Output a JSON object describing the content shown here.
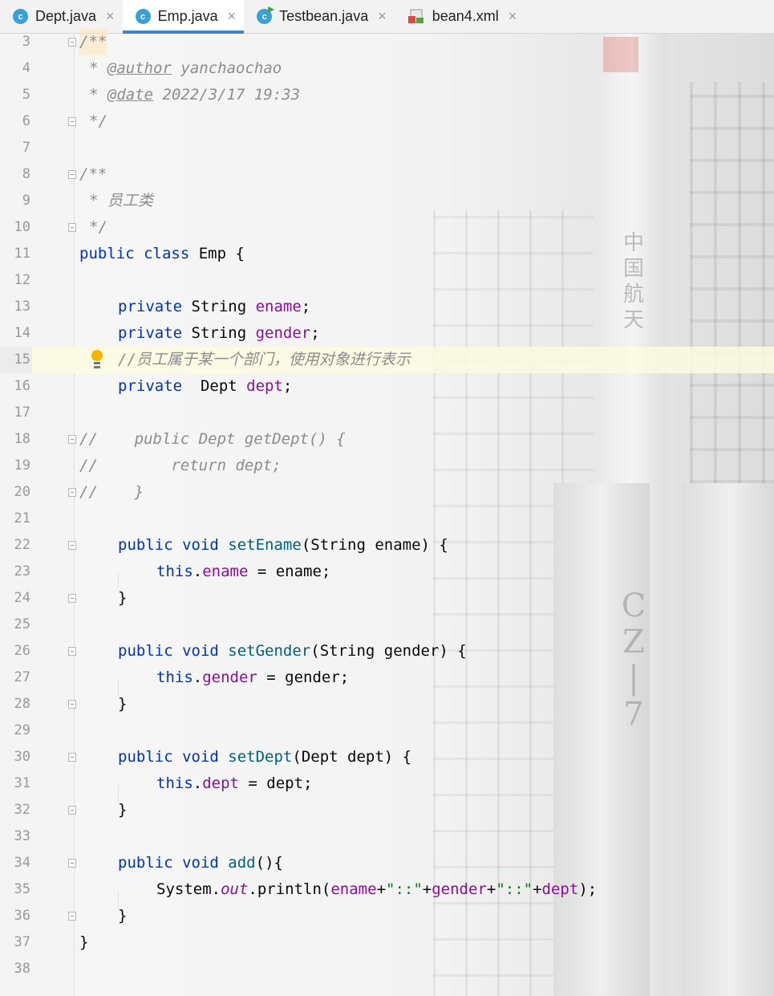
{
  "tabs": [
    {
      "label": "Dept.java",
      "icon": "java-class-icon",
      "close": "×"
    },
    {
      "label": "Emp.java",
      "icon": "java-class-icon",
      "close": "×"
    },
    {
      "label": "Testbean.java",
      "icon": "java-runnable-class-icon",
      "close": "×"
    },
    {
      "label": "bean4.xml",
      "icon": "xml-file-icon",
      "close": "×"
    }
  ],
  "active_tab": "Emp.java",
  "current_line": 15,
  "line_numbers": [
    "3",
    "4",
    "5",
    "6",
    "7",
    "8",
    "9",
    "10",
    "11",
    "12",
    "13",
    "14",
    "15",
    "16",
    "17",
    "18",
    "19",
    "20",
    "21",
    "22",
    "23",
    "24",
    "25",
    "26",
    "27",
    "28",
    "29",
    "30",
    "31",
    "32",
    "33",
    "34",
    "35",
    "36",
    "37",
    "38"
  ],
  "code": {
    "l3": {
      "a": "/**"
    },
    "l4": {
      "a": "* ",
      "b": "@author",
      "c": " yanchaochao"
    },
    "l5": {
      "a": "* ",
      "b": "@date",
      "c": " 2022/3/17 19:33"
    },
    "l6": {
      "a": "*/"
    },
    "l8": {
      "a": "/**"
    },
    "l9": {
      "a": "* 员工类"
    },
    "l10": {
      "a": "*/"
    },
    "l11": {
      "a": "public class",
      "b": " Emp {"
    },
    "l13": {
      "a": "private",
      "b": " String ",
      "c": "ename",
      ";": ";"
    },
    "l14": {
      "a": "private",
      "b": " String ",
      "c": "gender",
      ";": ";"
    },
    "l15": {
      "a": "//员工属于某一个部门，使用对象进行表示"
    },
    "l16": {
      "a": "private",
      "b": "  Dept ",
      "c": "dept",
      ";": ";"
    },
    "l18": {
      "a": "//    public Dept getDept() {"
    },
    "l19": {
      "a": "//        return dept;"
    },
    "l20": {
      "a": "//    }"
    },
    "l22": {
      "a": "public void",
      "b": " ",
      "c": "setEname",
      "d": "(String ename) {"
    },
    "l23": {
      "a": "this",
      "b": ".",
      "c": "ename",
      "d": " = ename;"
    },
    "l24": {
      "a": "}"
    },
    "l26": {
      "a": "public void",
      "b": " ",
      "c": "setGender",
      "d": "(String gender) {"
    },
    "l27": {
      "a": "this",
      "b": ".",
      "c": "gender",
      "d": " = gender;"
    },
    "l28": {
      "a": "}"
    },
    "l30": {
      "a": "public void",
      "b": " ",
      "c": "setDept",
      "d": "(Dept dept) {"
    },
    "l31": {
      "a": "this",
      "b": ".",
      "c": "dept",
      "d": " = dept;"
    },
    "l32": {
      "a": "}"
    },
    "l34": {
      "a": "public void",
      "b": " ",
      "c": "add",
      "d": "(){"
    },
    "l35": {
      "a": "System.",
      "b": "out",
      "c": ".println(",
      "d": "ename",
      "e": "+",
      "f": "\"::\"",
      "g": "+",
      "h": "gender",
      "i": "+",
      "j": "\"::\"",
      "k": "+",
      "l": "dept",
      "m": ");"
    },
    "l36": {
      "a": "}"
    },
    "l37": {
      "a": "}"
    }
  },
  "background_text": [
    "中",
    "国",
    "航",
    "天",
    "C",
    "Z",
    "|",
    "7"
  ],
  "colors": {
    "keyword": "#0033b3",
    "field": "#871094",
    "comment": "#8c8c8c",
    "method": "#00627a",
    "string": "#067d17",
    "active_tab_underline": "#4083c9"
  }
}
